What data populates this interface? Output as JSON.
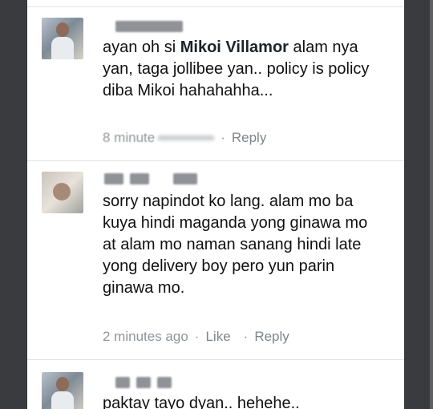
{
  "comments": [
    {
      "text_before": "ayan oh si ",
      "mention": "Mikoi Villamor",
      "text_after": " alam nya yan, taga jollibee yan.. policy is policy diba Mikoi hahahahha...",
      "time": "8 minute",
      "reply_label": "Reply"
    },
    {
      "text": "sorry napindot ko lang.  alam mo ba kuya hindi maganda yong ginawa mo at alam mo naman sanang hindi late yong delivery boy pero yun parin ginawa mo.",
      "time": "2 minutes ago",
      "like_label": "Like",
      "reply_label": "Reply"
    },
    {
      "text": "paktay tayo dyan..  hehehe.."
    }
  ],
  "separator": "·"
}
